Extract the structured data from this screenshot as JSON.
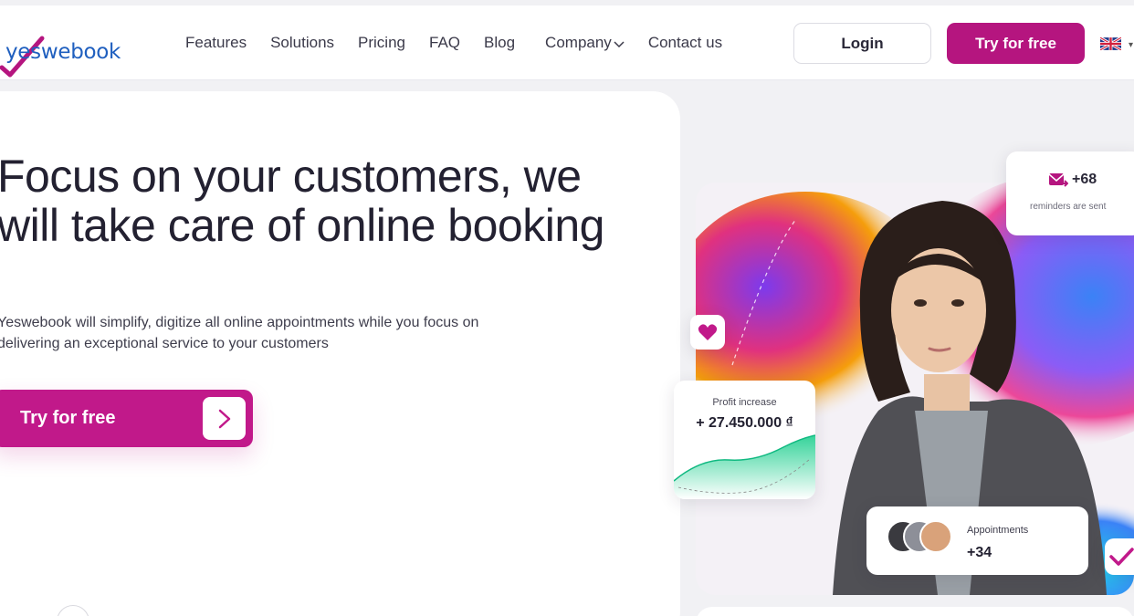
{
  "brand": {
    "logo_text": "yeswebook",
    "accent": "#b5157f",
    "logo_color": "#1f5fbf"
  },
  "nav": {
    "items": [
      {
        "label": "Features"
      },
      {
        "label": "Solutions"
      },
      {
        "label": "Pricing"
      },
      {
        "label": "FAQ"
      },
      {
        "label": "Blog"
      },
      {
        "label": "Company"
      },
      {
        "label": "Contact us"
      }
    ],
    "login_label": "Login",
    "try_label": "Try for free",
    "language_icon": "uk-flag-icon"
  },
  "hero": {
    "title": "Focus on your customers, we will take care of online booking",
    "subtitle": "Yeswebook will simplify, digitize all online appointments while you focus on delivering an exceptional service to your customers",
    "cta_label": "Try for free"
  },
  "visual": {
    "reminders": {
      "count": "+68",
      "label": "reminders are sent"
    },
    "profit": {
      "label": "Profit increase",
      "value": "+ 27.450.000 ₫"
    },
    "appointments": {
      "label": "Appointments",
      "value": "+34"
    }
  }
}
